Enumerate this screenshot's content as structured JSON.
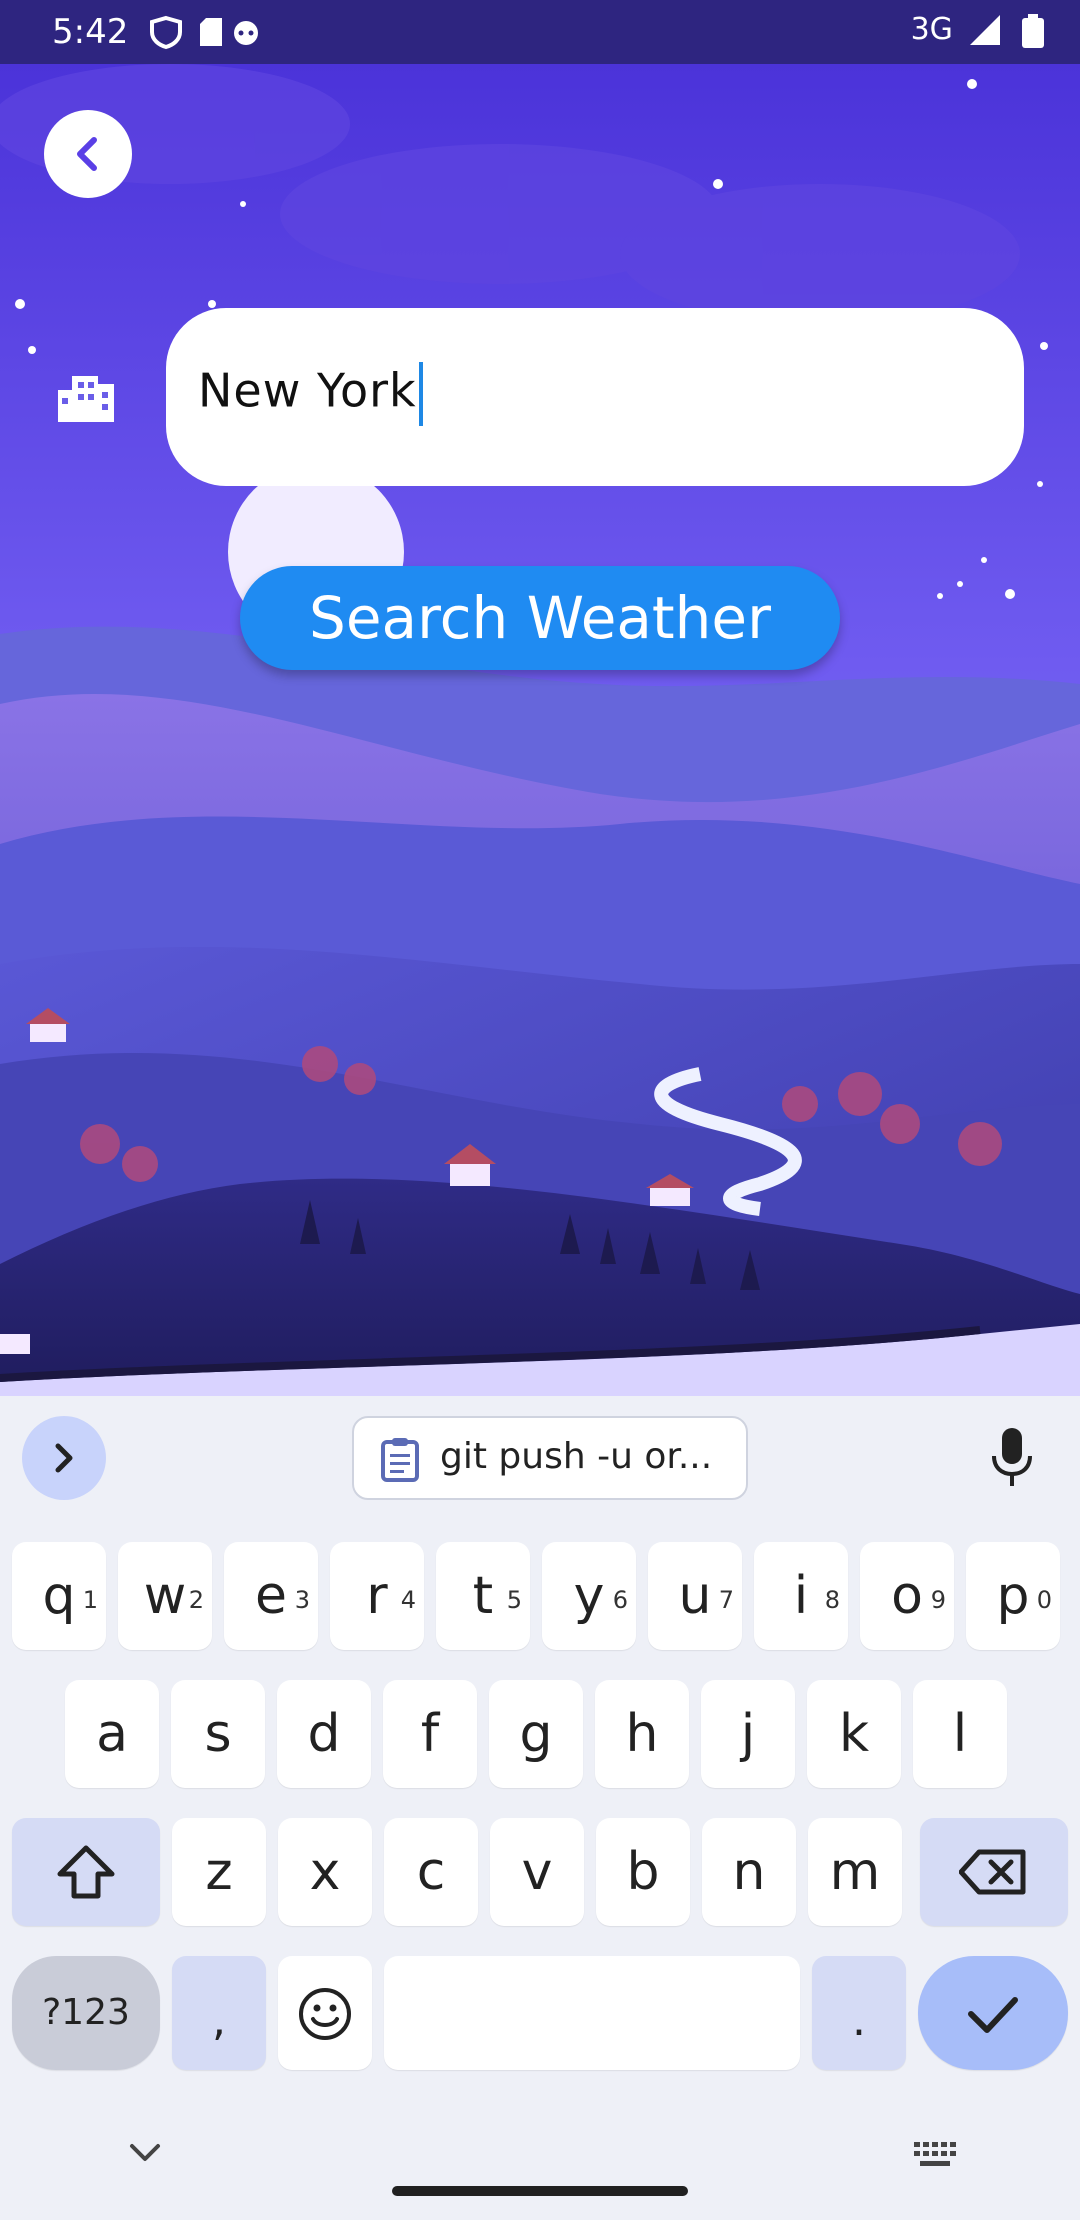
{
  "status_bar": {
    "time": "5:42",
    "network": "3G"
  },
  "city_input": {
    "value": "New York"
  },
  "search_button": {
    "label": "Search Weather"
  },
  "keyboard": {
    "suggestion": "git push -u or...",
    "row1": [
      {
        "k": "q",
        "h": "1"
      },
      {
        "k": "w",
        "h": "2"
      },
      {
        "k": "e",
        "h": "3"
      },
      {
        "k": "r",
        "h": "4"
      },
      {
        "k": "t",
        "h": "5"
      },
      {
        "k": "y",
        "h": "6"
      },
      {
        "k": "u",
        "h": "7"
      },
      {
        "k": "i",
        "h": "8"
      },
      {
        "k": "o",
        "h": "9"
      },
      {
        "k": "p",
        "h": "0"
      }
    ],
    "row2": [
      "a",
      "s",
      "d",
      "f",
      "g",
      "h",
      "j",
      "k",
      "l"
    ],
    "row3": [
      "z",
      "x",
      "c",
      "v",
      "b",
      "n",
      "m"
    ],
    "symbols_label": "?123",
    "comma": ",",
    "period": "."
  },
  "colors": {
    "accent": "#1f8bf2",
    "sky": "#5a4fe6",
    "keyboard_bg": "#eef0f7"
  }
}
